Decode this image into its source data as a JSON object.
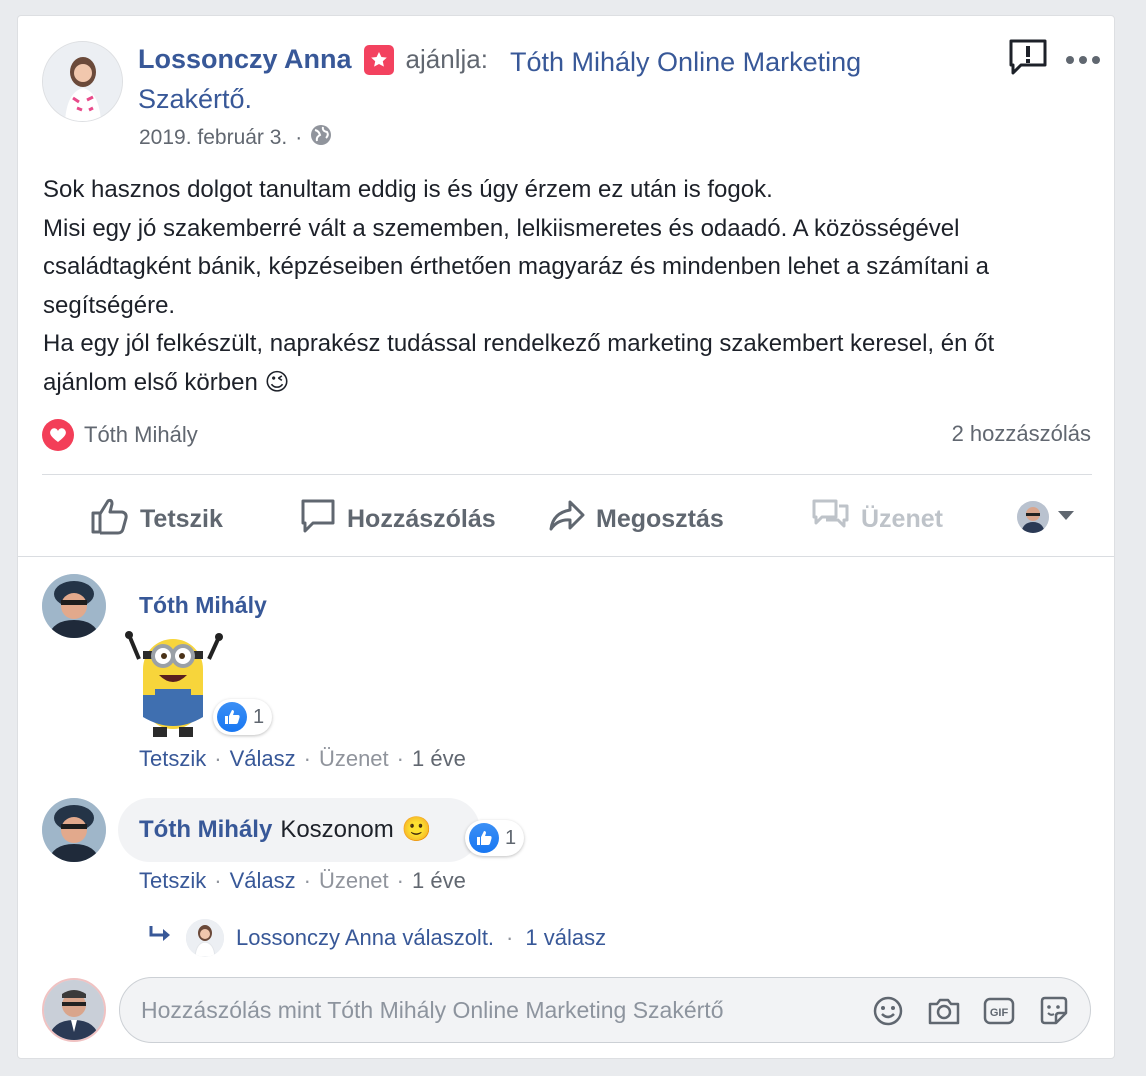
{
  "post": {
    "author": "Lossonczy Anna",
    "recommends_text": "ajánlja:",
    "page_name": "Tóth Mihály Online Marketing Szakértő.",
    "date": "2019. február 3.",
    "date_sep": "·",
    "body": "Sok hasznos dolgot tanultam eddig is és úgy érzem ez után is fogok.\nMisi egy jó szakemberré vált a szememben, lelkiismeretes és odaadó. A közösségével családtagként bánik, képzéseiben érthetően magyaráz és mindenben lehet a számítani a segítségére.\nHa egy jól felkészült, naprakész tudással rendelkező marketing szakembert keresel, én őt ajánlom első körben",
    "body_emoji": "😉",
    "reaction_name": "Tóth Mihály",
    "comments_count": "2 hozzászólás"
  },
  "actions": {
    "like": "Tetszik",
    "comment": "Hozzászólás",
    "share": "Megosztás",
    "message": "Üzenet"
  },
  "comments": [
    {
      "author": "Tóth Mihály",
      "text": "",
      "reaction_count": "1",
      "meta": {
        "like": "Tetszik",
        "reply": "Válasz",
        "message": "Üzenet",
        "time": "1 éve",
        "sep": "·"
      }
    },
    {
      "author": "Tóth Mihály",
      "text": "Koszonom",
      "emoji": "🙂",
      "reaction_count": "1",
      "meta": {
        "like": "Tetszik",
        "reply": "Válasz",
        "message": "Üzenet",
        "time": "1 éve",
        "sep": "·"
      },
      "replies_summary": {
        "text": "Lossonczy Anna válaszolt.",
        "sep": "·",
        "count": "1 válasz"
      }
    }
  ],
  "composer": {
    "placeholder": "Hozzászólás mint Tóth Mihály Online Marketing Szakértő",
    "icons": [
      "emoji-icon",
      "camera-icon",
      "gif-icon",
      "sticker-icon"
    ]
  },
  "colors": {
    "link": "#385898",
    "like_blue": "#1877f2",
    "heart_red": "#f33e58",
    "recommend_pink": "#f3425f"
  }
}
